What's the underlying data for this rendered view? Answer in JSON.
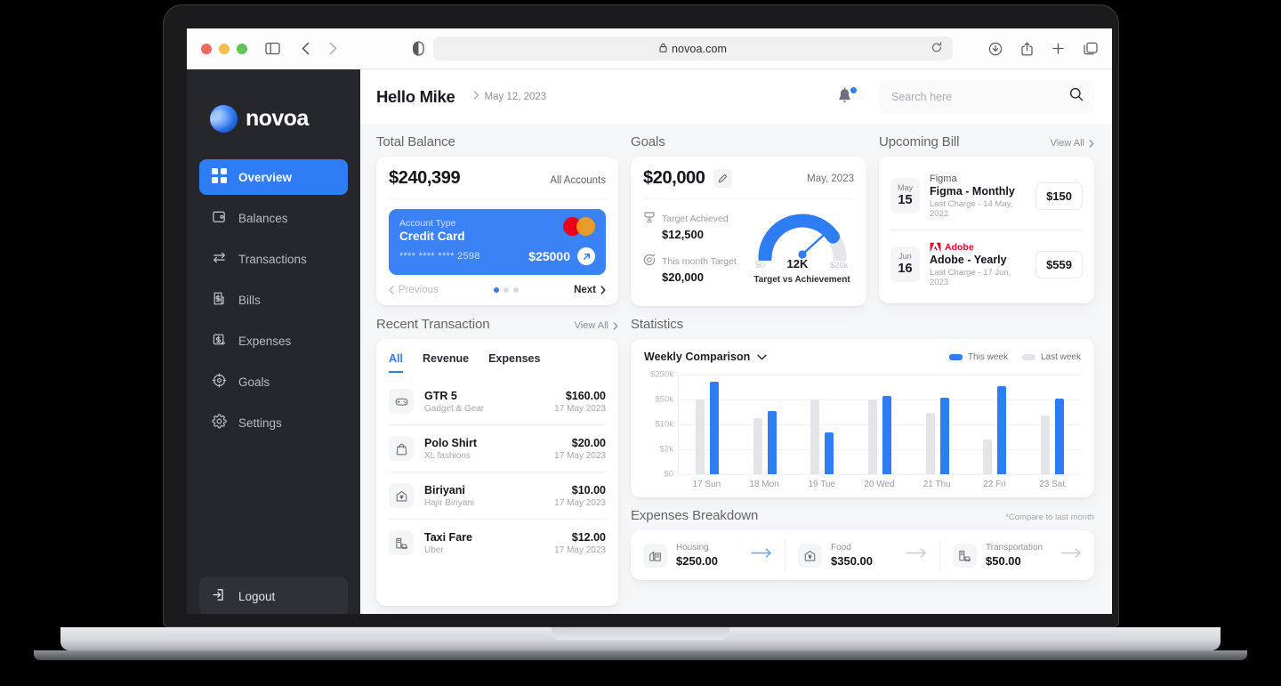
{
  "browser": {
    "url": "novoa.com",
    "lock_icon": "lock-icon",
    "reload_icon": "reload-icon"
  },
  "sidebar": {
    "brand": "novoa",
    "items": [
      {
        "label": "Overview",
        "icon": "grid-icon",
        "active": true
      },
      {
        "label": "Balances",
        "icon": "wallet-icon",
        "active": false
      },
      {
        "label": "Transactions",
        "icon": "transfer-icon",
        "active": false
      },
      {
        "label": "Bills",
        "icon": "bill-icon",
        "active": false
      },
      {
        "label": "Expenses",
        "icon": "expense-icon",
        "active": false
      },
      {
        "label": "Goals",
        "icon": "target-icon",
        "active": false
      },
      {
        "label": "Settings",
        "icon": "gear-icon",
        "active": false
      }
    ],
    "logout": "Logout"
  },
  "topbar": {
    "greeting": "Hello Mike",
    "date": "May 12, 2023",
    "search_placeholder": "Search here",
    "bell_icon": "bell-icon",
    "search_icon": "search-icon"
  },
  "total_balance": {
    "title": "Total Balance",
    "amount": "$240,399",
    "accounts_label": "All Accounts",
    "card": {
      "account_type_label": "Account Type",
      "account_type": "Credit Card",
      "number": "**** **** **** 2598",
      "amount": "$25000",
      "brand_icon": "mastercard-icon",
      "action_icon": "arrow-up-right-icon"
    },
    "previous": "Previous",
    "next": "Next",
    "pip_count": 3,
    "pip_active": 0
  },
  "goals": {
    "title": "Goals",
    "amount": "$20,000",
    "edit_icon": "pencil-icon",
    "month": "May, 2023",
    "target_achieved_label": "Target Achieved",
    "target_achieved_value": "$12,500",
    "month_target_label": "This month Target",
    "month_target_value": "$20,000",
    "gauge": {
      "min": "$0",
      "mid": "12K",
      "max": "$20k",
      "caption": "Target vs Achievement",
      "value": 12000,
      "max_value": 20000,
      "fill_color": "#2f7df4",
      "track_color": "#e4e5e8"
    }
  },
  "upcoming_bill": {
    "title": "Upcoming Bill",
    "view_all": "View All",
    "items": [
      {
        "month": "May",
        "day": "15",
        "brand": "Figma",
        "brand_icon": "figma-icon",
        "name": "Figma - Monthly",
        "last_charge": "Last Charge - 14 May, 2022",
        "amount": "$150"
      },
      {
        "month": "Jun",
        "day": "16",
        "brand": "Adobe",
        "brand_icon": "adobe-icon",
        "name": "Adobe - Yearly",
        "last_charge": "Last Charge - 17 Jun, 2023",
        "amount": "$559"
      }
    ]
  },
  "recent_transaction": {
    "title": "Recent Transaction",
    "view_all": "View All",
    "tabs": [
      {
        "label": "All",
        "active": true
      },
      {
        "label": "Revenue",
        "active": false
      },
      {
        "label": "Expenses",
        "active": false
      }
    ],
    "items": [
      {
        "name": "GTR 5",
        "merchant": "Gadget & Gear",
        "amount": "$160.00",
        "date": "17 May 2023",
        "icon": "gamepad-icon"
      },
      {
        "name": "Polo Shirt",
        "merchant": "XL fashions",
        "amount": "$20.00",
        "date": "17 May 2023",
        "icon": "bag-icon"
      },
      {
        "name": "Biriyani",
        "merchant": "Hajir Biriyani",
        "amount": "$10.00",
        "date": "17 May 2023",
        "icon": "restaurant-icon"
      },
      {
        "name": "Taxi Fare",
        "merchant": "Uber",
        "amount": "$12.00",
        "date": "17 May 2023",
        "icon": "taxi-icon"
      }
    ]
  },
  "statistics": {
    "title": "Statistics",
    "selector": "Weekly Comparison",
    "chevron_icon": "chevron-down-icon",
    "legend": [
      {
        "label": "This week",
        "color": "#2f7df4"
      },
      {
        "label": "Last week",
        "color": "#e4e5e8"
      }
    ]
  },
  "chart_data": {
    "type": "bar",
    "title": "Weekly Comparison",
    "categories": [
      "17 Sun",
      "18 Mon",
      "19 Tue",
      "20 Wed",
      "21 Thu",
      "22 Fri",
      "23 Sat"
    ],
    "ytick_labels": [
      "$0",
      "$2k",
      "$10k",
      "$50k",
      "$250k"
    ],
    "ytick_positions": [
      0,
      25,
      50,
      75,
      100
    ],
    "series": [
      {
        "name": "Last week",
        "color": "#e4e5e8",
        "values": [
          75,
          56,
          75,
          75,
          62,
          35,
          59
        ]
      },
      {
        "name": "This week",
        "color": "#2f7df4",
        "values": [
          93,
          63,
          42,
          79,
          77,
          88,
          76
        ]
      }
    ],
    "xlabel": "",
    "ylabel": "",
    "grid": true,
    "legend_position": "top-right"
  },
  "expenses_breakdown": {
    "title": "Expenses Breakdown",
    "note": "*Compare to last month",
    "items": [
      {
        "label": "Housing",
        "value": "$250.00",
        "icon": "building-icon",
        "arrow_color": "#6aa4f5"
      },
      {
        "label": "Food",
        "value": "$350.00",
        "icon": "restaurant-icon",
        "arrow_color": "#c8cad0"
      },
      {
        "label": "Transportation",
        "value": "$50.00",
        "icon": "taxi-icon",
        "arrow_color": "#c8cad0"
      }
    ]
  }
}
